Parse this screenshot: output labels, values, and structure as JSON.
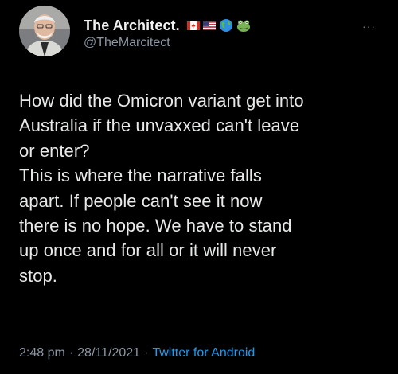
{
  "tweet": {
    "author": {
      "display_name": "The Architect.",
      "handle": "@TheMarcitect",
      "emojis": [
        "canada-flag-icon",
        "usa-flag-icon",
        "globe-icon",
        "frog-icon"
      ]
    },
    "text_lines": [
      "How did the Omicron variant get into",
      "Australia if the unvaxxed can't leave",
      "or enter?",
      "This is where the narrative falls",
      "apart. If people can't see it now",
      "there is no hope. We have to stand",
      "up once and for all or it will never",
      "stop."
    ],
    "time": "2:48 pm",
    "date": "28/11/2021",
    "source": "Twitter for Android",
    "separator": "·",
    "more_label": "···"
  },
  "colors": {
    "background": "#000000",
    "primary_text": "#e7e9ea",
    "secondary_text": "#8b98a5",
    "link": "#1d9bf0"
  }
}
